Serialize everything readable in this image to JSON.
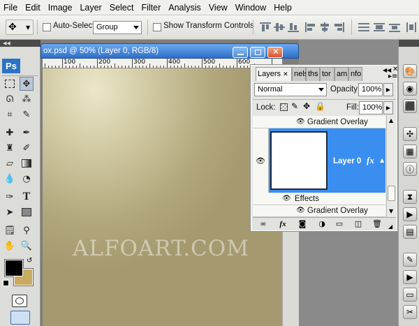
{
  "menu": [
    "File",
    "Edit",
    "Image",
    "Layer",
    "Select",
    "Filter",
    "Analysis",
    "View",
    "Window",
    "Help"
  ],
  "options_bar": {
    "auto_select_label": "Auto-Select:",
    "auto_select_value": "Group",
    "transform_label": "Show Transform Controls"
  },
  "document": {
    "title": "ox.psd @ 50% (Layer 0, RGB/8)",
    "ruler_labels": [
      "100",
      "200",
      "300",
      "400",
      "500",
      "600"
    ],
    "watermark": "ALFOART.COM",
    "canvas_colors": {
      "light": "#ebe7c8",
      "dark": "#a59a6f"
    }
  },
  "tools": {
    "logo": "Ps",
    "foreground_color": "#000000",
    "background_color": "#c8aa60"
  },
  "layers_panel": {
    "tabs": [
      "Layers",
      "nels",
      "ths",
      "tor",
      "am",
      "nfo"
    ],
    "blend_mode": "Normal",
    "opacity_label": "Opacity:",
    "opacity_value": "100%",
    "lock_label": "Lock:",
    "fill_label": "Fill:",
    "fill_value": "100%",
    "rows": {
      "gradient_top": "Gradient Overlay",
      "layer_name": "Layer 0",
      "fx": "fx",
      "effects": "Effects",
      "gradient_bottom": "Gradient Overlay"
    },
    "selection_color": "#3a8ef0"
  }
}
